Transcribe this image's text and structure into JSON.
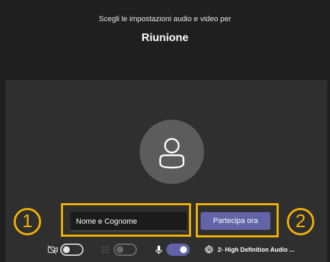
{
  "header": {
    "subtitle": "Scegli le impostazioni audio e video per",
    "title": "Riunione"
  },
  "join_form": {
    "name_placeholder": "Nome e Cognome",
    "join_label": "Partecipa ora"
  },
  "callouts": {
    "step1": "1",
    "step2": "2"
  },
  "controls": {
    "camera": {
      "icon": "camera-off-icon",
      "state": "off"
    },
    "background_blur": {
      "icon": "blur-icon",
      "state": "off"
    },
    "microphone": {
      "icon": "microphone-icon",
      "state": "on"
    },
    "audio_device_label": "2- High Definition Audio ..."
  },
  "colors": {
    "background": "#1f1f1f",
    "preview": "#2f2f2f",
    "accent": "#6264a7",
    "highlight": "#f5b400"
  }
}
